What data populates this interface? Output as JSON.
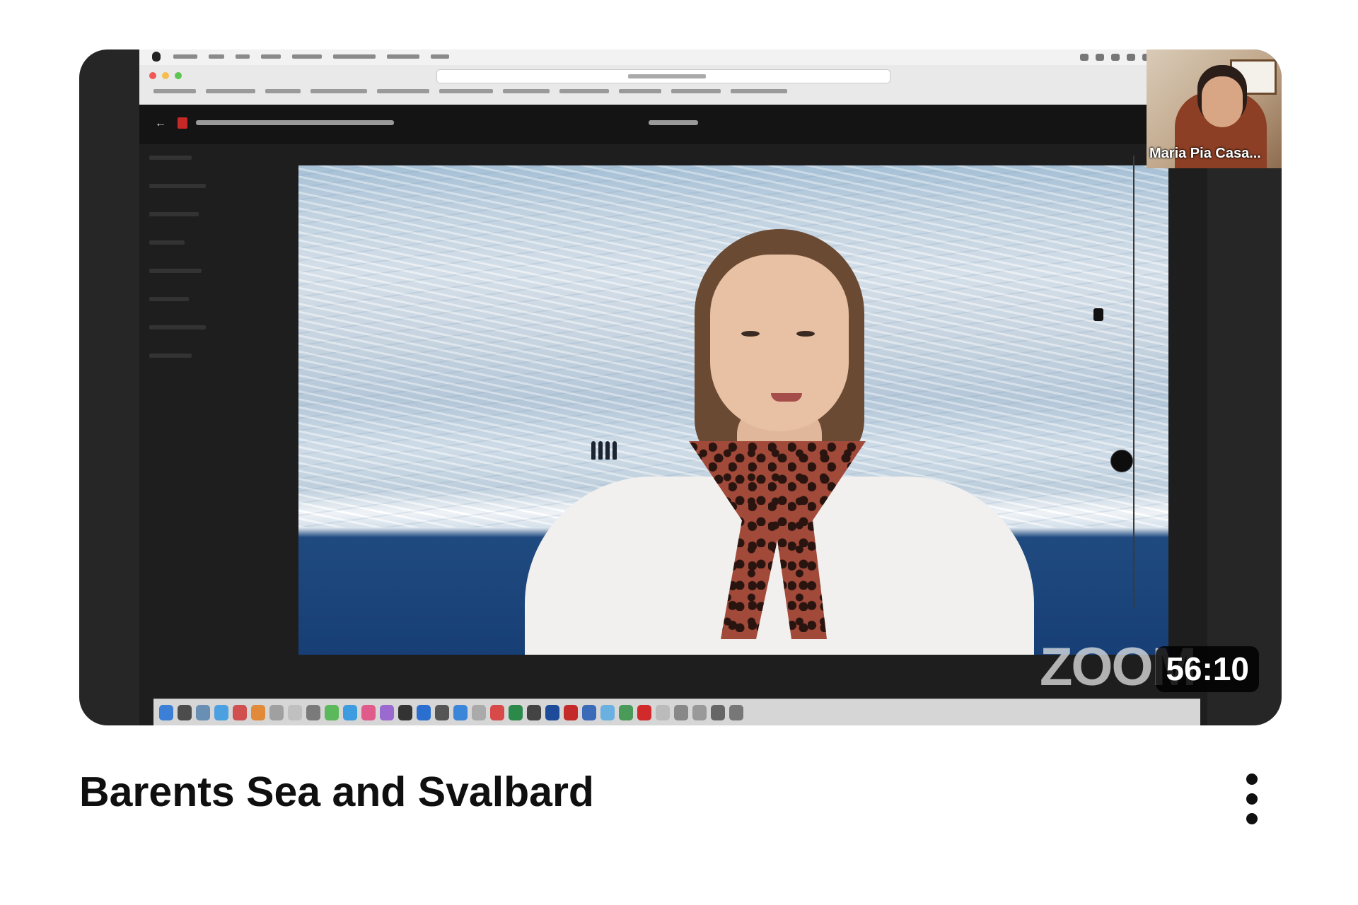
{
  "video": {
    "title": "Barents Sea and Svalbard",
    "duration": "56:10",
    "zoom_logo_text": "ZOOM"
  },
  "participant": {
    "name": "Maria Pia Casa..."
  },
  "icons": {
    "more": "more-vert-icon"
  },
  "colors": {
    "title_text": "#0f0f0f",
    "duration_badge_bg": "#000000",
    "thumbnail_frame": "#262626"
  }
}
